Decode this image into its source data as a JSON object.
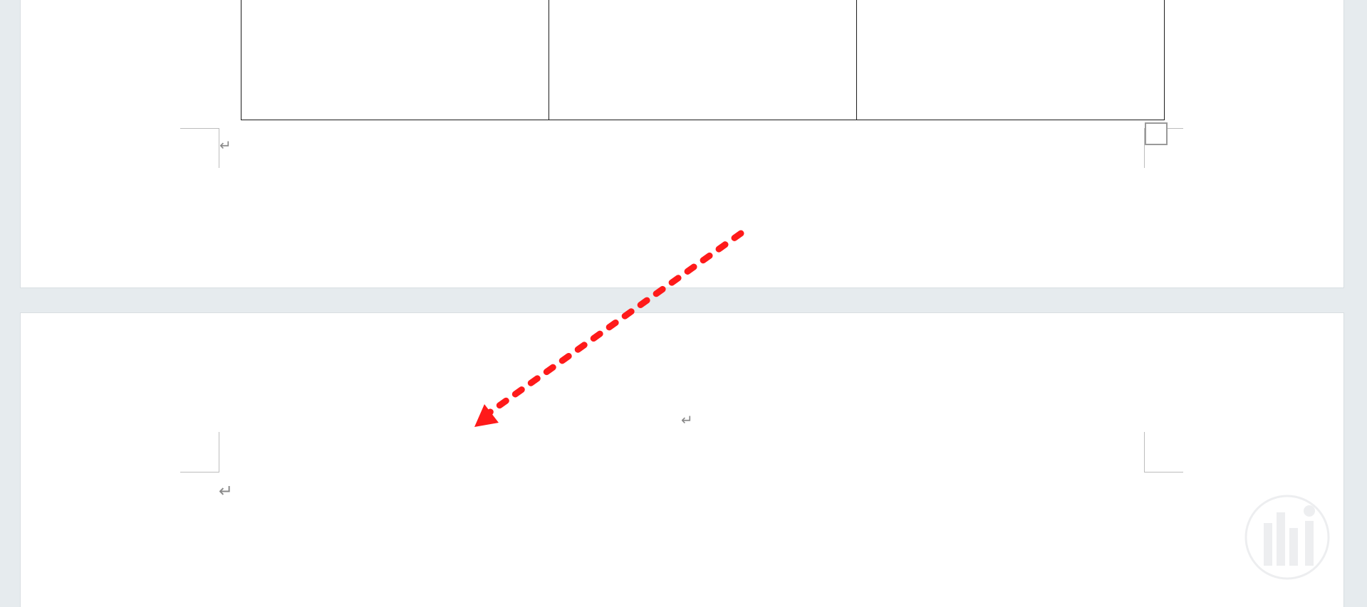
{
  "paragraph_mark_glyph": "↵",
  "colors": {
    "workspace_background": "#e6ebee",
    "page_background": "#ffffff",
    "annotation_arrow": "#ff1a1a",
    "table_border": "#1a1a1a",
    "formatting_marks": "#8a8a8a"
  },
  "annotation": {
    "type": "dashed-arrow",
    "icon": "arrow-down-left-icon"
  },
  "table": {
    "columns": 3,
    "cells": [
      "",
      "",
      ""
    ]
  }
}
